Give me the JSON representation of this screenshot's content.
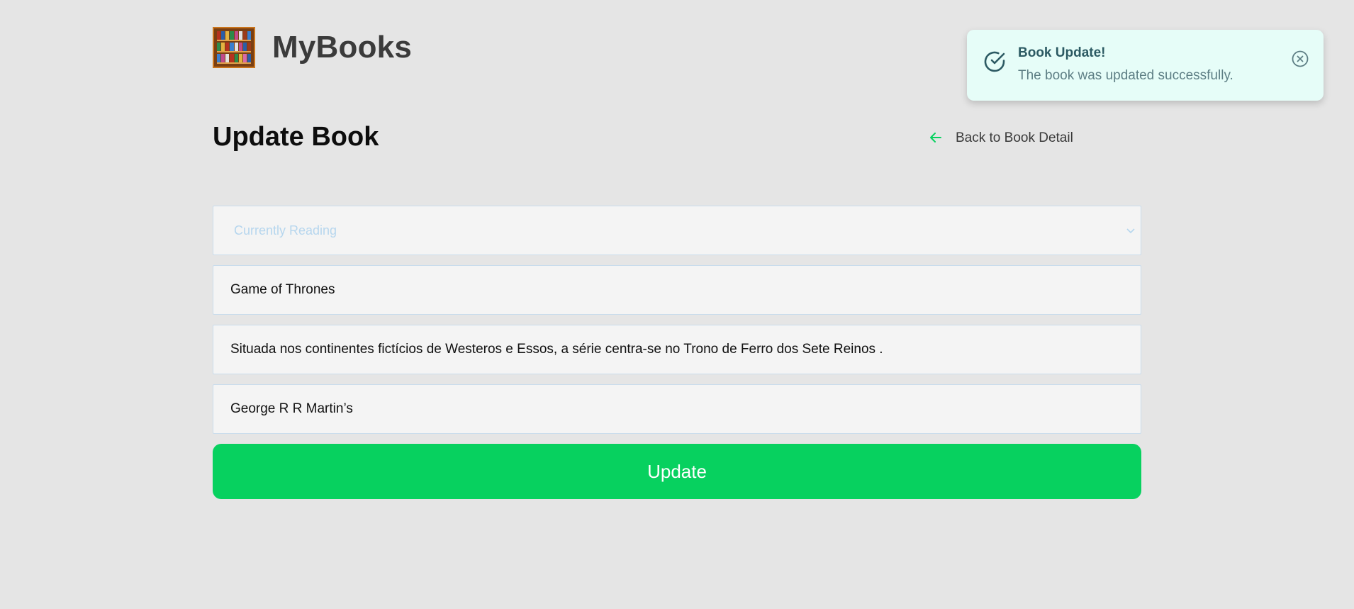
{
  "brand": {
    "name": "MyBooks",
    "logo": "bookshelf-logo"
  },
  "page": {
    "title": "Update Book"
  },
  "nav": {
    "back_label": "Back to Book Detail",
    "back_icon": "arrow-left-icon"
  },
  "form": {
    "status_select": {
      "selected": "Currently Reading"
    },
    "title_field": {
      "value": "Game of Thrones"
    },
    "description_field": {
      "value": "Situada nos continentes fictícios de Westeros e Essos, a série centra-se no Trono de Ferro dos Sete Reinos ."
    },
    "author_field": {
      "value": "George R R Martin’s"
    },
    "submit_label": "Update"
  },
  "toast": {
    "title": "Book Update!",
    "message": "The book was updated successfully.",
    "icon": "check-circle-icon",
    "close_icon": "close-circle-icon"
  },
  "colors": {
    "accent": "#07d15f",
    "background": "#e5e5e5",
    "toast_bg": "#e6fdf8",
    "toast_text": "#2c5a63"
  }
}
